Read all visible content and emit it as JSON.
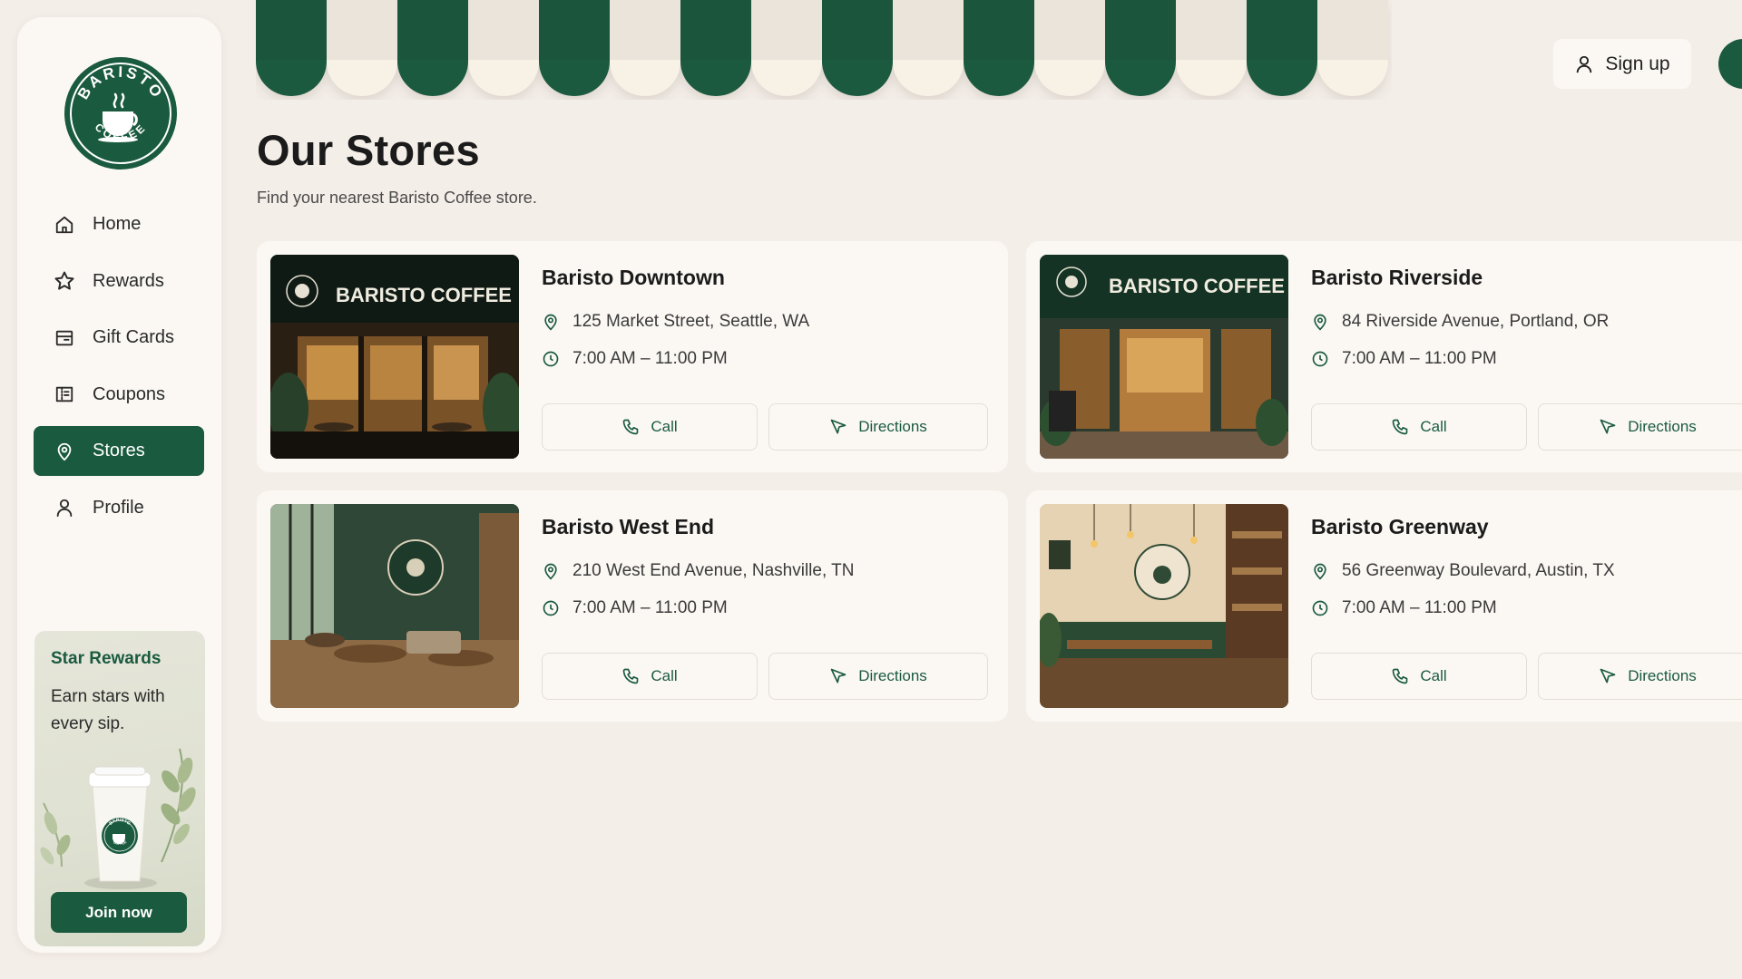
{
  "brand": {
    "logo_top": "BARISTO",
    "logo_bottom": "COFFEE",
    "primary_color": "#1a5a3f",
    "background_color": "#f4eee8"
  },
  "sidebar": {
    "items": [
      {
        "label": "Home",
        "icon": "home-icon"
      },
      {
        "label": "Rewards",
        "icon": "star-icon"
      },
      {
        "label": "Gift Cards",
        "icon": "gift-card-icon"
      },
      {
        "label": "Coupons",
        "icon": "coupon-icon"
      },
      {
        "label": "Stores",
        "icon": "location-pin-icon",
        "active": true
      },
      {
        "label": "Profile",
        "icon": "user-icon"
      }
    ],
    "promo": {
      "title": "Star Rewards",
      "text": "Earn stars with every sip.",
      "button": "Join now",
      "cup_logo_top": "BARISTO",
      "cup_logo_bottom": "COFFEE"
    }
  },
  "header": {
    "signup_label": "Sign up"
  },
  "page": {
    "title": "Our Stores",
    "subtitle": "Find your nearest Baristo Coffee store."
  },
  "stores": [
    {
      "name": "Baristo Downtown",
      "address": "125 Market Street, Seattle, WA",
      "hours": "7:00 AM – 11:00 PM",
      "call": "Call",
      "directions": "Directions",
      "sign_text": "BARISTO COFFEE"
    },
    {
      "name": "Baristo Riverside",
      "address": "84 Riverside Avenue, Portland, OR",
      "hours": "7:00 AM – 11:00 PM",
      "call": "Call",
      "directions": "Directions",
      "sign_text": "BARISTO COFFEE"
    },
    {
      "name": "Baristo West End",
      "address": "210 West End Avenue, Nashville, TN",
      "hours": "7:00 AM – 11:00 PM",
      "call": "Call",
      "directions": "Directions"
    },
    {
      "name": "Baristo Greenway",
      "address": "56 Greenway Boulevard, Austin, TX",
      "hours": "7:00 AM – 11:00 PM",
      "call": "Call",
      "directions": "Directions"
    }
  ]
}
